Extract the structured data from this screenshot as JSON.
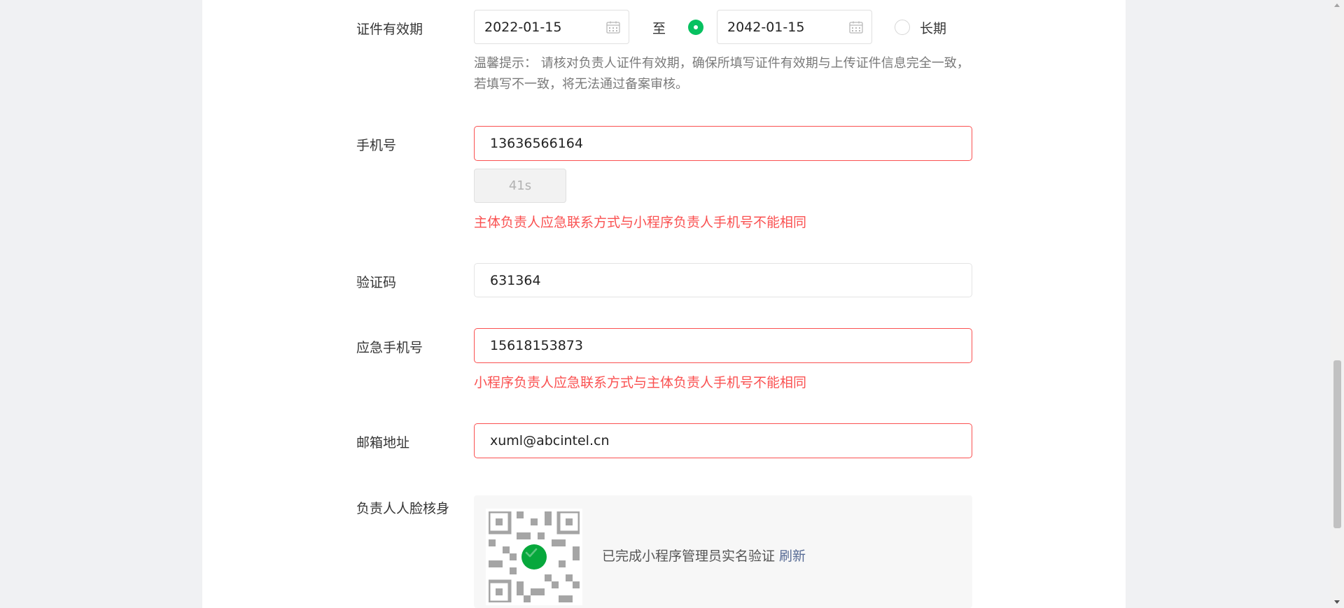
{
  "validity": {
    "label": "证件有效期",
    "start_date": "2022-01-15",
    "to_label": "至",
    "end_date": "2042-01-15",
    "long_term_label": "长期",
    "hint": "温馨提示： 请核对负责人证件有效期，确保所填写证件有效期与上传证件信息完全一致，若填写不一致，将无法通过备案审核。"
  },
  "phone": {
    "label": "手机号",
    "value": "13636566164",
    "countdown": "41s",
    "error": "主体负责人应急联系方式与小程序负责人手机号不能相同"
  },
  "verify_code": {
    "label": "验证码",
    "value": "631364"
  },
  "emergency_phone": {
    "label": "应急手机号",
    "value": "15618153873",
    "error": "小程序负责人应急联系方式与主体负责人手机号不能相同"
  },
  "email": {
    "label": "邮箱地址",
    "value": "xuml@abcintel.cn"
  },
  "face_verify": {
    "label": "负责人人脸核身",
    "status": "已完成小程序管理员实名验证",
    "refresh_label": "刷新"
  },
  "colors": {
    "accent_green": "#07c160",
    "error_red": "#fa5151",
    "link_blue": "#576b95"
  }
}
